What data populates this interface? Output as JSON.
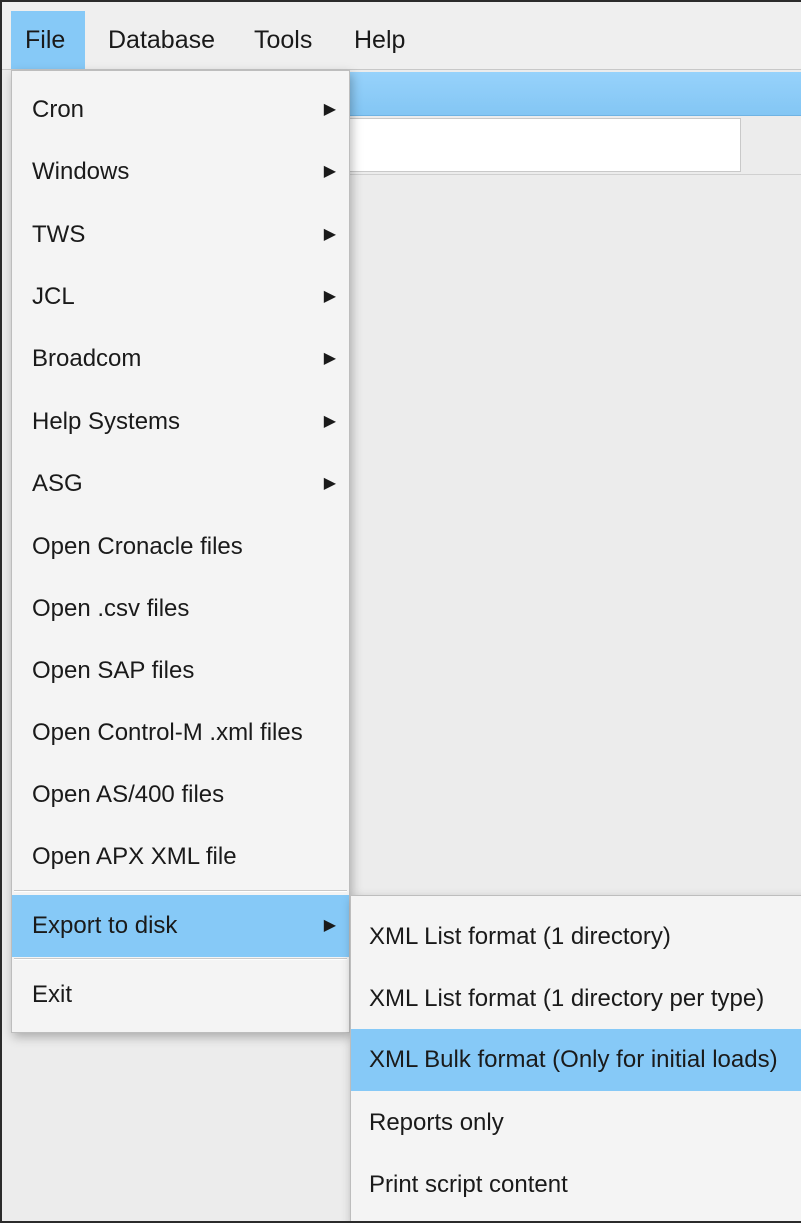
{
  "menubar": {
    "items": [
      {
        "label": "File",
        "active": true
      },
      {
        "label": "Database",
        "active": false
      },
      {
        "label": "Tools",
        "active": false
      },
      {
        "label": "Help",
        "active": false
      }
    ]
  },
  "file_menu": {
    "items": [
      {
        "label": "Cron",
        "submenu": true
      },
      {
        "label": "Windows",
        "submenu": true
      },
      {
        "label": "TWS",
        "submenu": true
      },
      {
        "label": "JCL",
        "submenu": true
      },
      {
        "label": "Broadcom",
        "submenu": true
      },
      {
        "label": "Help Systems",
        "submenu": true
      },
      {
        "label": "ASG",
        "submenu": true
      },
      {
        "label": "Open Cronacle files",
        "submenu": false
      },
      {
        "label": "Open .csv files",
        "submenu": false
      },
      {
        "label": "Open SAP files",
        "submenu": false
      },
      {
        "label": "Open Control-M .xml files",
        "submenu": false
      },
      {
        "label": "Open AS/400 files",
        "submenu": false
      },
      {
        "label": "Open APX XML file",
        "submenu": false
      },
      {
        "label": "Export to disk",
        "submenu": true,
        "highlighted": true
      },
      {
        "label": "Exit",
        "submenu": false
      }
    ]
  },
  "export_submenu": {
    "items": [
      {
        "label": "XML List format (1 directory)"
      },
      {
        "label": "XML List format (1 directory per type)"
      },
      {
        "label": "XML Bulk format (Only for initial loads)",
        "highlighted": true
      },
      {
        "label": "Reports only"
      },
      {
        "label": "Print script content"
      }
    ]
  },
  "colors": {
    "highlight": "#86c9f7",
    "menu_bg": "#f4f4f4",
    "menubar_bg": "#efefef"
  },
  "icons": {
    "submenu_arrow": "chevron-right-icon"
  }
}
